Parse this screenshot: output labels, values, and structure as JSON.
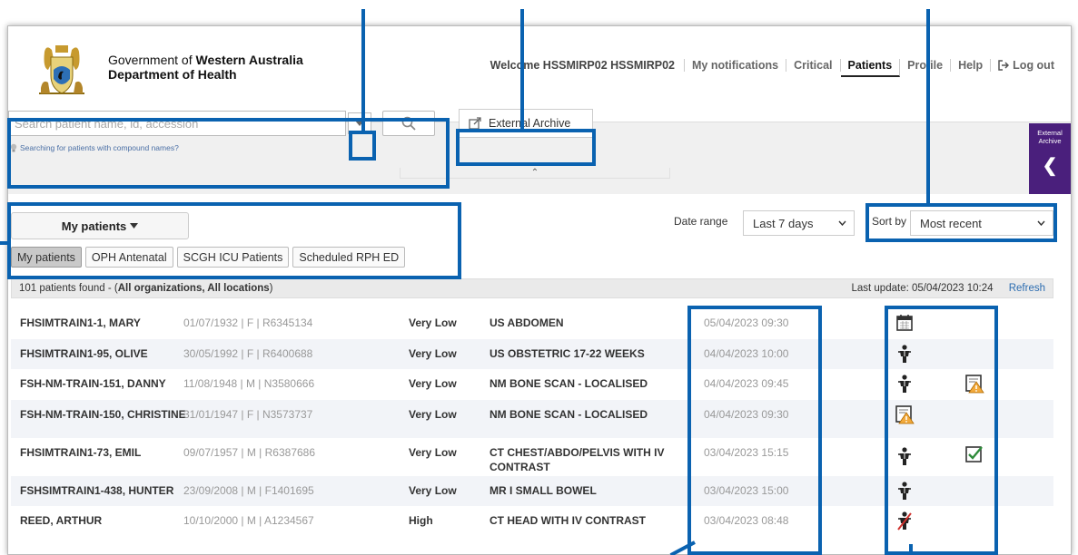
{
  "header": {
    "gov_prefix": "Government of",
    "gov_bold": "Western Australia",
    "department": "Department of Health",
    "welcome": "Welcome HSSMIRP02 HSSMIRP02",
    "nav": [
      "My notifications",
      "Critical",
      "Patients",
      "Profile",
      "Help",
      "Log out"
    ],
    "active_nav": "Patients"
  },
  "search": {
    "placeholder": "Search patient name, id, accession",
    "hint": "Searching for patients with compound names?"
  },
  "external_archive": {
    "button_label": "External Archive",
    "panel_label": "External Archive"
  },
  "filters": {
    "patient_list_dropdown": "My patients",
    "tabs": [
      "My patients",
      "OPH Antenatal",
      "SCGH ICU Patients",
      "Scheduled RPH ED"
    ],
    "active_tab": "My patients",
    "date_range_label": "Date range",
    "date_range_value": "Last 7 days",
    "sort_label": "Sort by",
    "sort_value": "Most recent"
  },
  "results": {
    "count_prefix": "101 patients found - (",
    "count_bold": "All organizations, All locations",
    "count_suffix": ")",
    "last_update": "Last update: 05/04/2023 10:24",
    "refresh": "Refresh"
  },
  "patients": [
    {
      "name": "FHSIMTRAIN1-1, MARY",
      "info": "01/07/1932 | F | R6345134",
      "priority": "Very Low",
      "procedure": "US ABDOMEN",
      "datetime": "05/04/2023 09:30",
      "icon1": "calendar-icon",
      "icon2": ""
    },
    {
      "name": "FHSIMTRAIN1-95, OLIVE",
      "info": "30/05/1992 | F | R6400688",
      "priority": "Very Low",
      "procedure": "US OBSTETRIC 17-22 WEEKS",
      "datetime": "04/04/2023 10:00",
      "icon1": "patient-icon",
      "icon2": ""
    },
    {
      "name": "FSH-NM-TRAIN-151, DANNY",
      "info": "11/08/1948 | M | N3580666",
      "priority": "Very Low",
      "procedure": "NM BONE SCAN - LOCALISED",
      "datetime": "04/04/2023 09:45",
      "icon1": "patient-icon",
      "icon2": "report-warning-icon"
    },
    {
      "name": "FSH-NM-TRAIN-150, CHRISTINE",
      "info": "31/01/1947 | F | N3573737",
      "priority": "Very Low",
      "procedure": "NM BONE SCAN - LOCALISED",
      "datetime": "04/04/2023 09:30",
      "icon1": "report-warning-icon",
      "icon2": ""
    },
    {
      "name": "FHSIMTRAIN1-73, EMIL",
      "info": "09/07/1957 | M | R6387686",
      "priority": "Very Low",
      "procedure": "CT CHEST/ABDO/PELVIS WITH IV CONTRAST",
      "datetime": "03/04/2023 15:15",
      "icon1": "patient-icon",
      "icon2": "report-checked-icon"
    },
    {
      "name": "FSHSIMTRAIN1-438, HUNTER",
      "info": "23/09/2008 | M | F1401695",
      "priority": "Very Low",
      "procedure": "MR I SMALL BOWEL",
      "datetime": "03/04/2023 15:00",
      "icon1": "patient-icon",
      "icon2": ""
    },
    {
      "name": "REED, ARTHUR",
      "info": "10/10/2000 | M | A1234567",
      "priority": "High",
      "procedure": "CT HEAD WITH IV CONTRAST",
      "datetime": "03/04/2023 08:48",
      "icon1": "patient-cancelled-icon",
      "icon2": ""
    }
  ],
  "colors": {
    "annotation": "#0a62b0",
    "external_archive_panel": "#4a1f7c",
    "refresh_link": "#2b6cb0"
  }
}
